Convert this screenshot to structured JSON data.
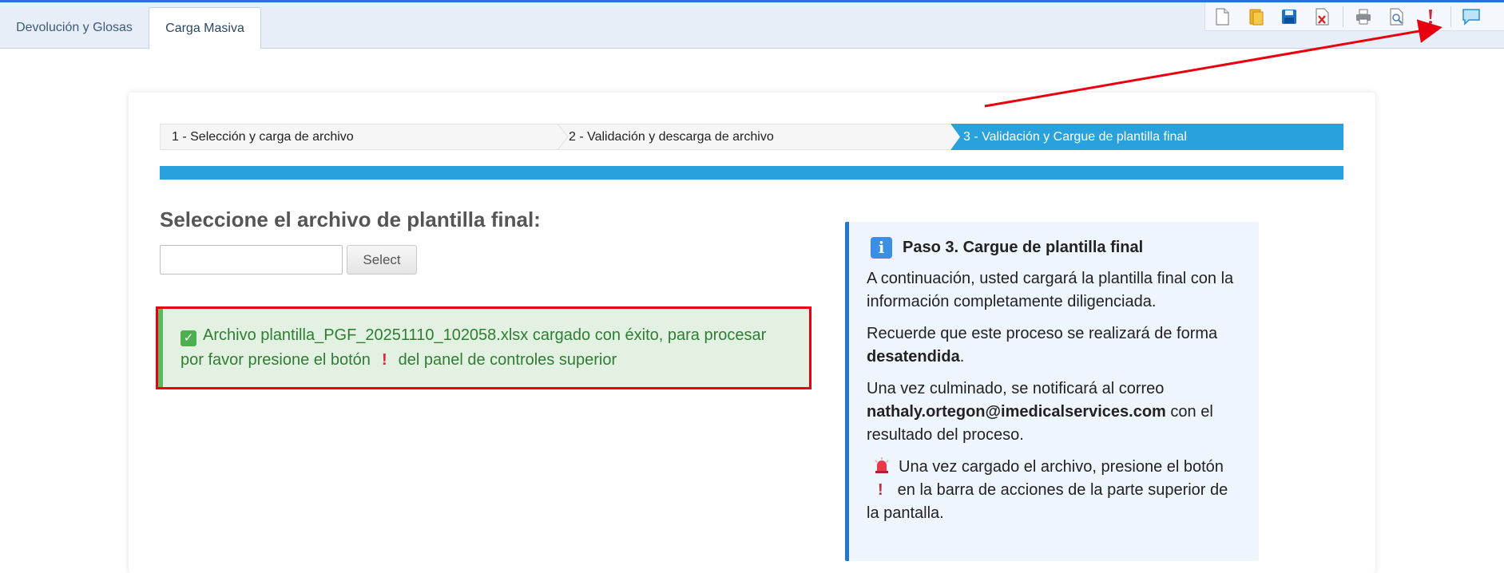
{
  "tabs": [
    {
      "label": "Devolución y Glosas",
      "active": false
    },
    {
      "label": "Carga Masiva",
      "active": true
    }
  ],
  "toolbar": {
    "buttons": [
      "new-file-icon",
      "open-folder-icon",
      "save-icon",
      "delete-icon",
      "print-icon",
      "print-preview-icon",
      "process-exclamation-icon",
      "comment-icon"
    ]
  },
  "wizard": {
    "steps": [
      {
        "label": "1 - Selección y carga de archivo",
        "active": false
      },
      {
        "label": "2 - Validación y descarga de archivo",
        "active": false
      },
      {
        "label": "3 - Validación y Cargue de plantilla final",
        "active": true
      }
    ]
  },
  "upload": {
    "heading": "Seleccione el archivo de plantilla final:",
    "file_value": "",
    "select_label": "Select"
  },
  "alert": {
    "text_before": "Archivo plantilla_PGF_20251110_102058.xlsx cargado con éxito, para procesar por favor presione el botón",
    "text_after": "del panel de controles superior"
  },
  "info": {
    "title": "Paso 3. Cargue de plantilla final",
    "p1": "A continuación, usted cargará la plantilla final con la información completamente diligenciada.",
    "p2_before": "Recuerde que este proceso se realizará de forma",
    "p2_bold": "desatendida",
    "p2_after": ".",
    "p3_before": "Una vez culminado, se notificará al correo",
    "p3_email": "nathaly.ortegon@imedicalservices.com",
    "p3_after": "con el resultado del proceso.",
    "p4_before": "Una vez cargado el archivo, presione el botón",
    "p4_after": "en la barra de acciones de la parte superior de la pantalla."
  },
  "colors": {
    "accent": "#29a1dd",
    "success_bg": "#e3f1e3",
    "success_text": "#2f7d32",
    "highlight_red": "#e8000e",
    "info_border": "#1f78d1"
  }
}
